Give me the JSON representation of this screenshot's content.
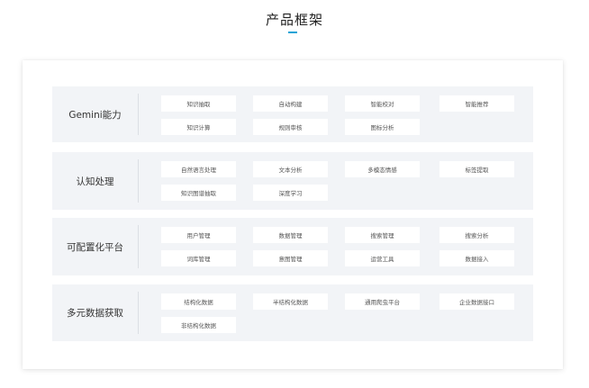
{
  "page": {
    "title": "产品框架"
  },
  "colors": {
    "accent": "#1aa3d6",
    "section_bg": "#f2f4f7",
    "chip_bg": "#ffffff"
  },
  "sections": [
    {
      "label": "Gemini能力",
      "items": [
        "知识抽取",
        "自动构建",
        "智能校对",
        "智能推荐",
        "知识计算",
        "规则审核",
        "图标分析"
      ]
    },
    {
      "label": "认知处理",
      "items": [
        "自然语言处理",
        "文本分析",
        "多模态情感",
        "标签提取",
        "知识图谱抽取",
        "深度学习"
      ]
    },
    {
      "label": "可配置化平台",
      "items": [
        "用户管理",
        "数据管理",
        "搜索管理",
        "搜索分析",
        "词库管理",
        "意图管理",
        "运营工具",
        "数据接入"
      ]
    },
    {
      "label": "多元数据获取",
      "items": [
        "结构化数据",
        "半结构化数据",
        "通用爬虫平台",
        "企业数据接口",
        "非结构化数据"
      ]
    }
  ]
}
